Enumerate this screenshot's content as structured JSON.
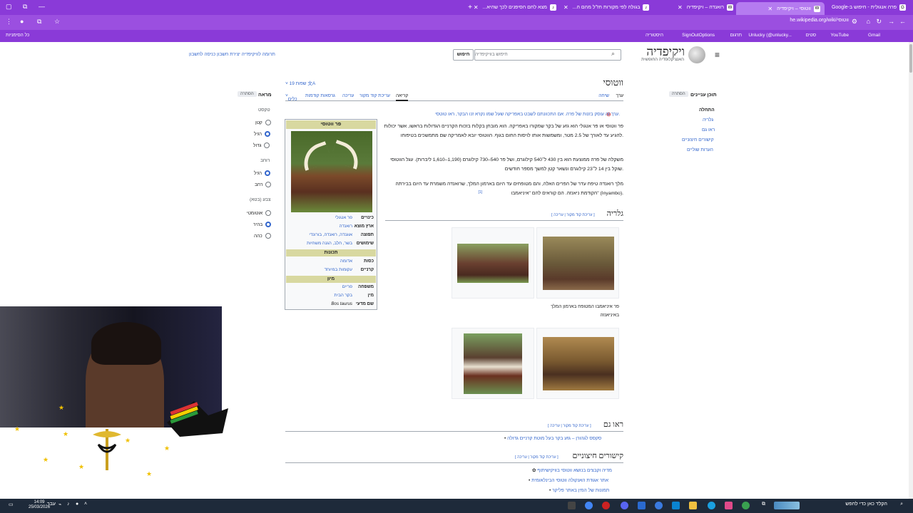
{
  "browser": {
    "tabs": [
      {
        "label": "פרה אנגולית - חיפוש ב-Google",
        "active": false
      },
      {
        "label": "ווטוסי – ויקיפדיה",
        "active": true
      },
      {
        "label": "רואנדה – ויקיפדיה",
        "active": false
      },
      {
        "label": "בגולה לפי מקורות חז\"ל מהם ה...",
        "active": false
      },
      {
        "label": "מצא לחם הסיפנים לכך שהיא...",
        "active": false
      }
    ],
    "new_tab": "+",
    "url": "he.wikipedia.org/wiki/ווטוסי",
    "bookmarks": [
      "כל הסימניות",
      "היסטוריה",
      "SignOutOptions",
      "תרגום",
      "Unlucky (@unlucky...",
      "סטים",
      "YouTube",
      "Gmail"
    ]
  },
  "wiki": {
    "site_name": "ויקיפדיה",
    "site_tagline": "האנציקלופדיה החופשית",
    "search_placeholder": "חיפוש בוויקיפדיה",
    "search_button": "חיפוש",
    "top_links": "תרומה לוויקיפדיה   יצירת חשבון   כניסה לחשבון",
    "toc": {
      "title": "תוכן עניינים",
      "hide": "הסתרה",
      "items": [
        "התחלה",
        "גלריה",
        "ראו גם",
        "קישורים חיצוניים",
        "הערות שוליים"
      ]
    },
    "article_title": "ווטוסי",
    "languages": "19 שפות",
    "tabs_right": [
      "ערך",
      "שיחה"
    ],
    "tabs_left": [
      "קריאה",
      "עריכת קוד מקור",
      "עריכה",
      "גרסאות קודמות",
      "כלים"
    ],
    "appearance": {
      "title": "מראה",
      "hide": "הסתרה",
      "text_label": "טקסט",
      "text_opts": [
        "קטן",
        "רגיל",
        "גדול"
      ],
      "width_label": "רוחב",
      "width_opts": [
        "רגיל",
        "רחב"
      ],
      "color_label": "צבע (בטא)",
      "color_opts": [
        "אוטומטי",
        "בהיר",
        "כהה"
      ]
    },
    "hatnote": "ערך זה עוסק בזנות של פרה. אם התכוונתם לשבט באפריקה שעל שמו נקרא זנו הבקר, ראו טוטסי.",
    "para1": "פר ווטוסי או פר אנגולי הוא גזע של בקר שמקורו באפריקה. הוא מובחן בקלות בזכות הקרניים הגדולות בראשו, אשר יכולות להגיע עד לאורך של 2.5 מטר, ומשמשות אותו לויסות החום בגוף. הווטוסי יובא לאמריקה שם מתמשכים בטיפוחו.",
    "para2": "משקלה של פרה ממוצעת הוא בין 430 ל־540 קילוגרם, ושל פר 540–730 קילוגרם (1,190–1,610 ליברות). עגל הווטוסי שוקל בין 14 ל־23 קילוגרם ונשאר קטן למשך מספר חודשים.",
    "para3": "מלך רואנדה טיפח עדר של הפרים האלה, והם מטופחים עד היום בארמון המלך, שרואנדה משמרת עד היום בבירתה הקודמת ניאנזה. הם קוראים להם \"איניאמבו\" (Inyambo).",
    "footnote": "[1]",
    "infobox": {
      "title": "פר ווטוסי",
      "rows": [
        {
          "k": "כינויים",
          "v": "פר אנגולי"
        },
        {
          "k": "ארץ מוצא",
          "v": "רואנדה"
        },
        {
          "k": "תפוצה",
          "v": "אוגנדה, רואנדה, בורונדי"
        },
        {
          "k": "שימושים",
          "v": "בשר, חלב, הגנה משחיות"
        }
      ],
      "sec1": "תכונות",
      "rows2": [
        {
          "k": "כסות",
          "v": "אדומה"
        },
        {
          "k": "קרניים",
          "v": "עקומות במיוחד"
        }
      ],
      "sec2": "מיון",
      "rows3": [
        {
          "k": "משפחה",
          "v": "פריים"
        },
        {
          "k": "מין",
          "v": "בקר הבית"
        },
        {
          "k": "שם מדעי",
          "v": "Bos taurus"
        }
      ]
    },
    "gallery_title": "גלריה",
    "edit_links": "[ עריכת קוד מקור | עריכה ]",
    "gallery_caption": "פר איניאמבו המטופח בארמון המלך באיניאנזה",
    "see_also_title": "ראו גם",
    "see_also_item": "סקסס לגהורן – גזע בקר בעל מוטת קרניים גדולה",
    "external_title": "קישורים חיצוניים",
    "external_items": [
      "מדיה וקבצים בנושא ווטוסי בוויקישיתוף",
      "אתר אגודת האנקולה ווטוסי הבינלאומית",
      "תמונות של המין באתר פליקר"
    ]
  },
  "taskbar": {
    "search_text": "הקלד כאן כדי לחפש",
    "time": "14:09",
    "date": "25/03/2026",
    "lang": "עבר"
  }
}
